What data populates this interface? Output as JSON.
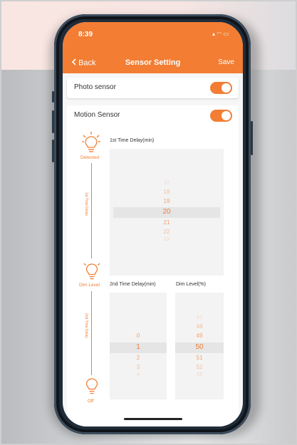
{
  "status": {
    "time": "8:39",
    "icons": "▴ ◠ ▭"
  },
  "nav": {
    "back": "Back",
    "title": "Sensor Setting",
    "save": "Save"
  },
  "photo_sensor": {
    "label": "Photo sensor",
    "enabled": true
  },
  "motion_sensor": {
    "label": "Motion Sensor",
    "enabled": true
  },
  "stages": {
    "detected": "Detected",
    "dim_level": "Dim Level",
    "off": "Off",
    "first_delay_vertical": "1st Time Delay",
    "second_delay_vertical": "2nd Time Delay"
  },
  "picker1": {
    "title": "1st Time Delay(min)",
    "items": [
      "17",
      "18",
      "19",
      "20",
      "21",
      "22",
      "23"
    ],
    "selected": "20"
  },
  "picker2": {
    "title": "2nd Time Delay(min)",
    "items": [
      "0",
      "1",
      "2",
      "3",
      "4"
    ],
    "selected": "1"
  },
  "picker3": {
    "title": "Dim Level(%)",
    "items": [
      "47",
      "48",
      "49",
      "50",
      "51",
      "52",
      "53"
    ],
    "selected": "50"
  },
  "colors": {
    "accent": "#f27d33",
    "header": "#f27d33"
  }
}
